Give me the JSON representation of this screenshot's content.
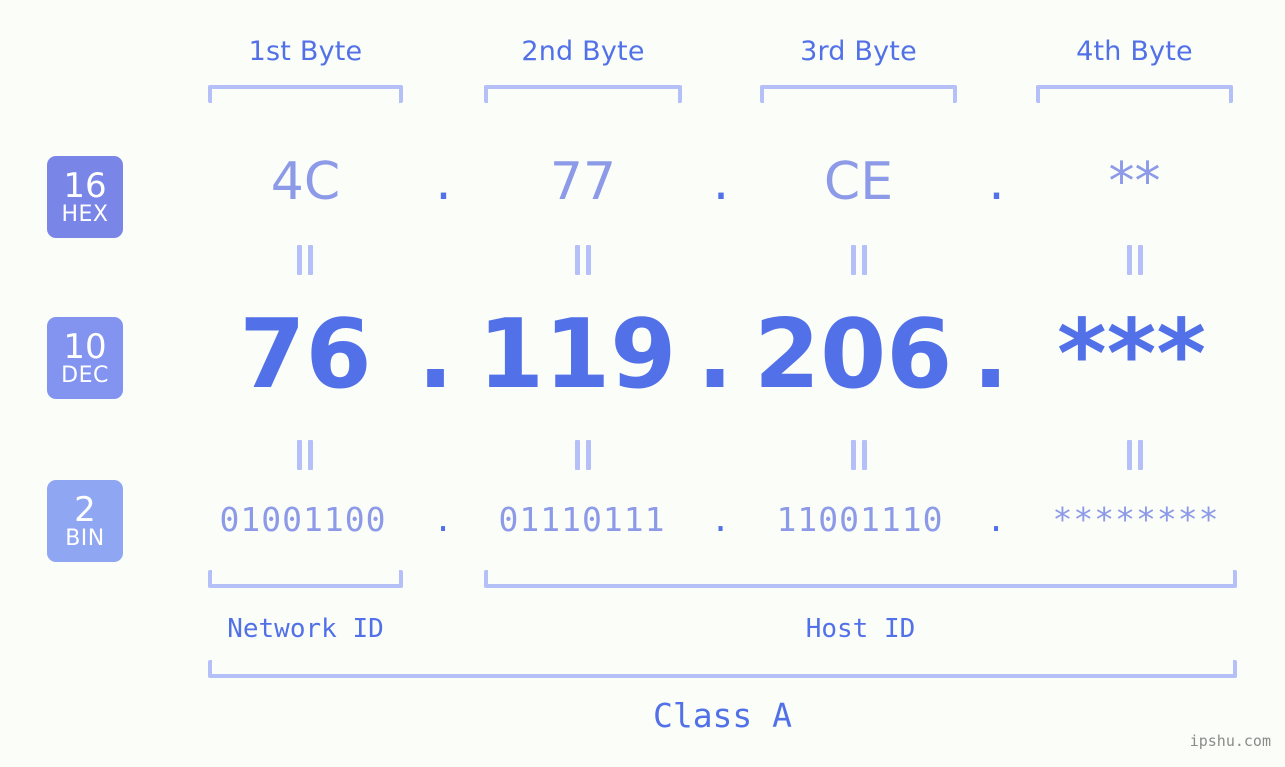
{
  "page": {
    "background": "#fbfdf8",
    "watermark": "ipshu.com"
  },
  "colors": {
    "accent_strong": "#5271e8",
    "accent_light": "#8c9ae8",
    "bracket": "#b6c0f8",
    "badge_hex": "#7986e8",
    "badge_dec": "#8294f0",
    "badge_bin": "#8fa6f2"
  },
  "byte_headers": [
    {
      "label": "1st Byte"
    },
    {
      "label": "2nd Byte"
    },
    {
      "label": "3rd Byte"
    },
    {
      "label": "4th Byte"
    }
  ],
  "radix_badges": [
    {
      "number": "16",
      "word": "HEX",
      "color": "#7986e8"
    },
    {
      "number": "10",
      "word": "DEC",
      "color": "#8294f0"
    },
    {
      "number": "2",
      "word": "BIN",
      "color": "#8fa6f2"
    }
  ],
  "rows": {
    "hex": {
      "values": [
        "4C",
        "77",
        "CE",
        "**"
      ],
      "separator": "."
    },
    "dec": {
      "values": [
        "76",
        "119",
        "206",
        "***"
      ],
      "separator": "."
    },
    "bin": {
      "values": [
        "01001100",
        "01110111",
        "11001110",
        "********"
      ],
      "separator": "."
    }
  },
  "equality_marker": "=",
  "sections": [
    {
      "label": "Network ID"
    },
    {
      "label": "Host ID"
    }
  ],
  "class_label": "Class A"
}
